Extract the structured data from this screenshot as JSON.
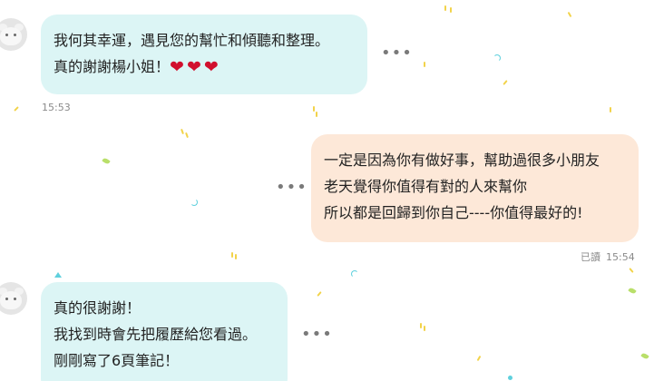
{
  "messages": [
    {
      "lines": [
        "我何其幸運，遇見您的幫忙和傾聽和整理。",
        "真的謝謝楊小姐！"
      ],
      "hearts": [
        "❤",
        "❤",
        "❤"
      ],
      "time": "15:53"
    },
    {
      "lines": [
        "一定是因為你有做好事，幫助過很多小朋友",
        "老天覺得你值得有對的人來幫你",
        "所以都是回歸到你自己----你值得最好的!"
      ],
      "read": "已讀",
      "time": "15:54"
    },
    {
      "lines": [
        "真的很謝謝！",
        "我找到時會先把履歷給您看過。",
        "剛剛寫了6頁筆記！"
      ]
    }
  ],
  "icons": {
    "more": "more-dots-icon",
    "avatar": "avatar-icon",
    "heart": "heart-icon"
  },
  "colors": {
    "incoming_bubble": "#dcf5f5",
    "outgoing_bubble": "#fde8d8",
    "heart": "#d10f2d",
    "timestamp": "#8a8a8a",
    "confetti_yellow": "#f2d34a",
    "confetti_green": "#b9df6a",
    "confetti_blue": "#5fd0dd"
  },
  "more_label": "•••"
}
